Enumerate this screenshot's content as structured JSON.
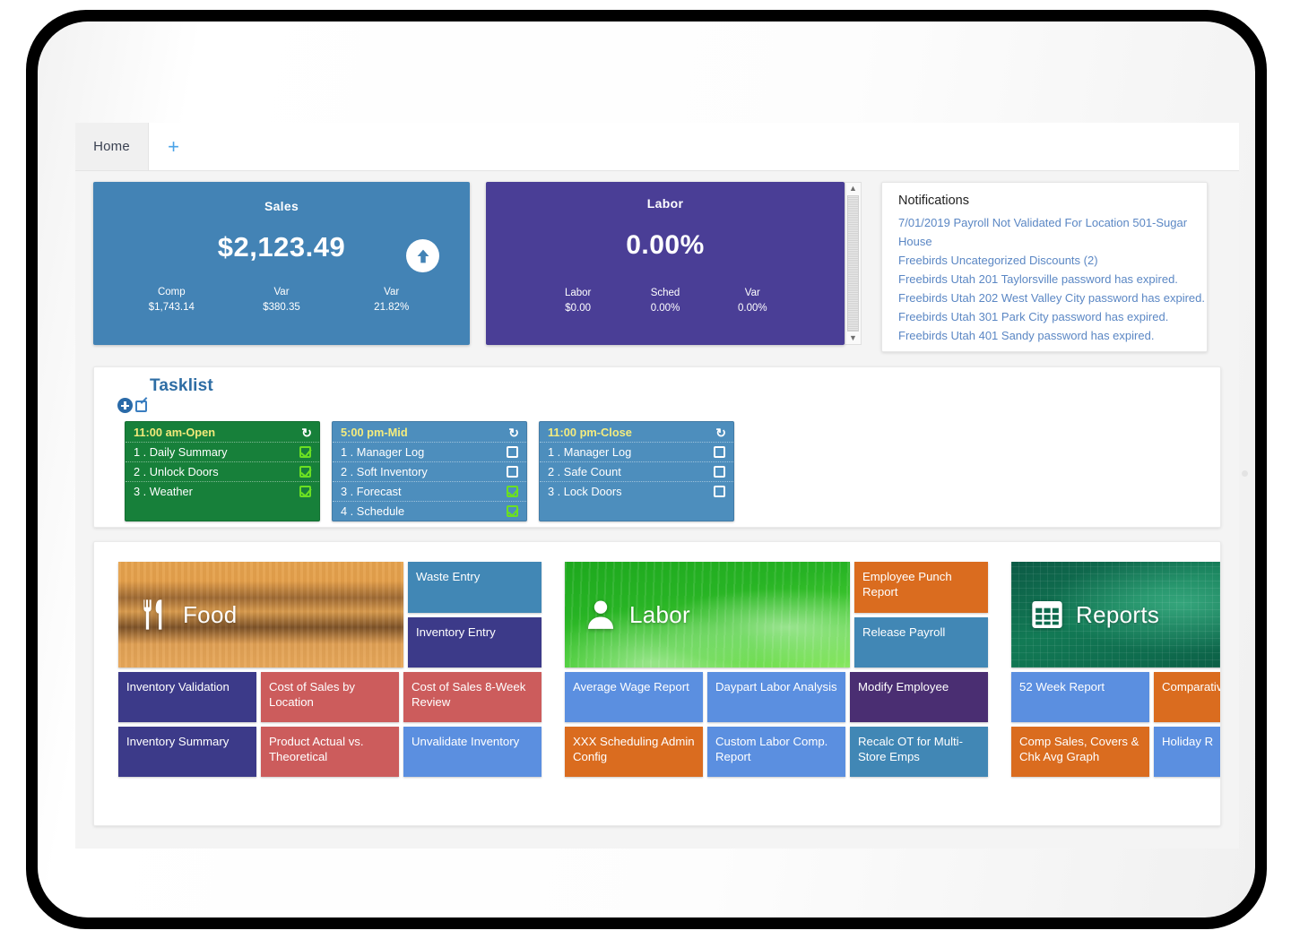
{
  "tabs": {
    "items": [
      {
        "label": "Home"
      }
    ],
    "add_label": "+"
  },
  "kpi": {
    "sales": {
      "title": "Sales",
      "value": "$2,123.49",
      "arrow_icon": "arrow-up-circle-icon",
      "color": "#4383b5",
      "stats": [
        {
          "label": "Comp",
          "value": "$1,743.14"
        },
        {
          "label": "Var",
          "value": "$380.35"
        },
        {
          "label": "Var",
          "value": "21.82%"
        }
      ]
    },
    "labor": {
      "title": "Labor",
      "value": "0.00%",
      "color": "#4a3e96",
      "stats": [
        {
          "label": "Labor",
          "value": "$0.00"
        },
        {
          "label": "Sched",
          "value": "0.00%"
        },
        {
          "label": "Var",
          "value": "0.00%"
        }
      ],
      "scroll_up_icon": "scroll-up-arrow-icon",
      "scroll_down_icon": "scroll-down-arrow-icon"
    }
  },
  "notifications": {
    "title": "Notifications",
    "items": [
      "7/01/2019 Payroll Not Validated For Location 501-Sugar House",
      "Freebirds Uncategorized Discounts (2)",
      "Freebirds Utah 201 Taylorsville password has expired.",
      "Freebirds Utah 202 West Valley City password has expired.",
      "Freebirds Utah 301 Park City password has expired.",
      "Freebirds Utah 401 Sandy password has expired."
    ]
  },
  "tasklist": {
    "title": "Tasklist",
    "add_icon": "add-circle-icon",
    "edit_icon": "edit-square-icon",
    "refresh_icon": "refresh-icon",
    "cards": [
      {
        "header": "11:00 am-Open",
        "color": "#17803a",
        "tasks": [
          {
            "label": "1 . Daily Summary",
            "done": true
          },
          {
            "label": "2 . Unlock Doors",
            "done": true
          },
          {
            "label": "3 . Weather",
            "done": true
          }
        ]
      },
      {
        "header": "5:00 pm-Mid",
        "color": "#4d8ebd",
        "tasks": [
          {
            "label": "1 . Manager Log",
            "done": false
          },
          {
            "label": "2 . Soft Inventory",
            "done": false
          },
          {
            "label": "3 . Forecast",
            "done": true
          },
          {
            "label": "4 . Schedule",
            "done": true
          }
        ]
      },
      {
        "header": "11:00 pm-Close",
        "color": "#4d8ebd",
        "tasks": [
          {
            "label": "1 . Manager Log",
            "done": false
          },
          {
            "label": "2 . Safe Count",
            "done": false
          },
          {
            "label": "3 . Lock Doors",
            "done": false
          }
        ]
      }
    ]
  },
  "tile_groups": [
    {
      "hero_label": "Food",
      "hero_icon": "fork-knife-icon",
      "side_tiles": [
        {
          "label": "Waste Entry",
          "color": "#4187b5"
        },
        {
          "label": "Inventory Entry",
          "color": "#3c3a89"
        }
      ],
      "rows": [
        [
          {
            "label": "Inventory Validation",
            "color": "#3c3a89"
          },
          {
            "label": "Cost of Sales by Location",
            "color": "#cc5c5c"
          },
          {
            "label": "Cost of Sales 8-Week Review",
            "color": "#cc5c5c"
          }
        ],
        [
          {
            "label": "Inventory Summary",
            "color": "#3c3a89"
          },
          {
            "label": "Product Actual vs. Theoretical",
            "color": "#cc5c5c"
          },
          {
            "label": "Unvalidate Inventory",
            "color": "#5b8fe0"
          }
        ]
      ]
    },
    {
      "hero_label": "Labor",
      "hero_icon": "person-icon",
      "side_tiles": [
        {
          "label": "Employee Punch Report",
          "color": "#da6c1f"
        },
        {
          "label": "Release Payroll",
          "color": "#4187b5"
        }
      ],
      "rows": [
        [
          {
            "label": "Average Wage Report",
            "color": "#5b8fe0"
          },
          {
            "label": "Daypart Labor Analysis",
            "color": "#5b8fe0"
          },
          {
            "label": "Modify Employee",
            "color": "#4a2e72"
          }
        ],
        [
          {
            "label": "XXX Scheduling Admin Config",
            "color": "#da6c1f"
          },
          {
            "label": "Custom Labor Comp. Report",
            "color": "#5b8fe0"
          },
          {
            "label": "Recalc OT for Multi-Store Emps",
            "color": "#4187b5"
          }
        ]
      ]
    },
    {
      "hero_label": "Reports",
      "hero_icon": "table-grid-icon",
      "side_tiles": [],
      "rows": [
        [
          {
            "label": "52 Week Report",
            "color": "#5b8fe0"
          },
          {
            "label": "Comparative Covers & ",
            "color": "#da6c1f"
          }
        ],
        [
          {
            "label": "Comp Sales, Covers & Chk Avg Graph",
            "color": "#da6c1f"
          },
          {
            "label": "Holiday R",
            "color": "#5b8fe0"
          }
        ]
      ]
    }
  ]
}
